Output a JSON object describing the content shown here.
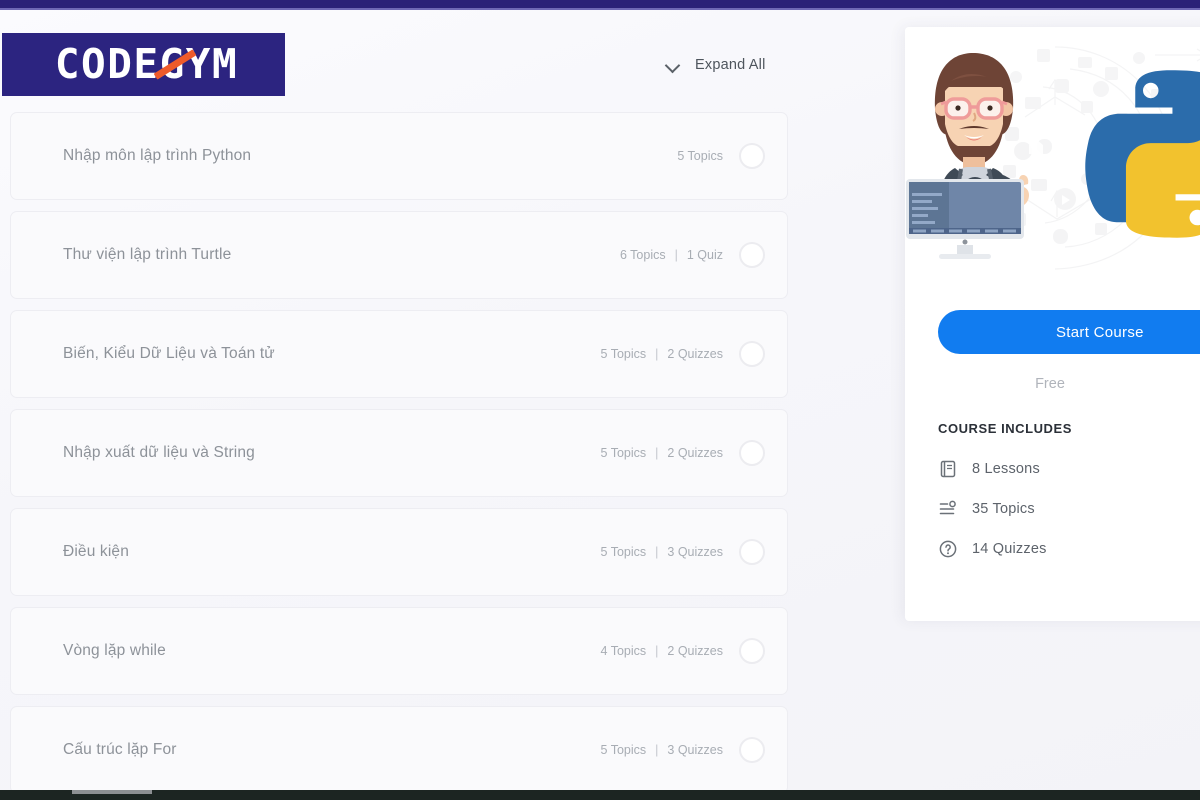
{
  "brand": {
    "logo_text": "CODEGYM",
    "logo_bg": "#2c2480",
    "logo_accent": "#ee5b2b"
  },
  "toolbar": {
    "expand_all_label": "Expand All",
    "chevron_icon": "chevron-down-icon"
  },
  "curriculum": {
    "lessons": [
      {
        "title": "Nhập môn lập trình Python",
        "topics": "5 Topics",
        "quizzes": "",
        "separator": ""
      },
      {
        "title": "Thư viện lập trình Turtle",
        "topics": "6 Topics",
        "quizzes": "1 Quiz",
        "separator": "|"
      },
      {
        "title": "Biến, Kiểu Dữ Liệu và Toán tử",
        "topics": "5 Topics",
        "quizzes": "2 Quizzes",
        "separator": "|"
      },
      {
        "title": "Nhập xuất dữ liệu và String",
        "topics": "5 Topics",
        "quizzes": "2 Quizzes",
        "separator": "|"
      },
      {
        "title": "Điều kiện",
        "topics": "5 Topics",
        "quizzes": "3 Quizzes",
        "separator": "|"
      },
      {
        "title": "Vòng lặp while",
        "topics": "4 Topics",
        "quizzes": "2 Quizzes",
        "separator": "|"
      },
      {
        "title": "Cấu trúc lặp For",
        "topics": "5 Topics",
        "quizzes": "3 Quizzes",
        "separator": "|"
      }
    ]
  },
  "sidebar": {
    "hero_alt": "python-course-hero-illustration",
    "start_button_label": "Start Course",
    "start_button_color": "#117cf0",
    "price_label": "Free",
    "includes_heading": "COURSE INCLUDES",
    "includes": [
      {
        "icon": "book-icon",
        "label": "8 Lessons"
      },
      {
        "icon": "topic-list-icon",
        "label": "35 Topics"
      },
      {
        "icon": "question-circle-icon",
        "label": "14 Quizzes"
      }
    ]
  }
}
